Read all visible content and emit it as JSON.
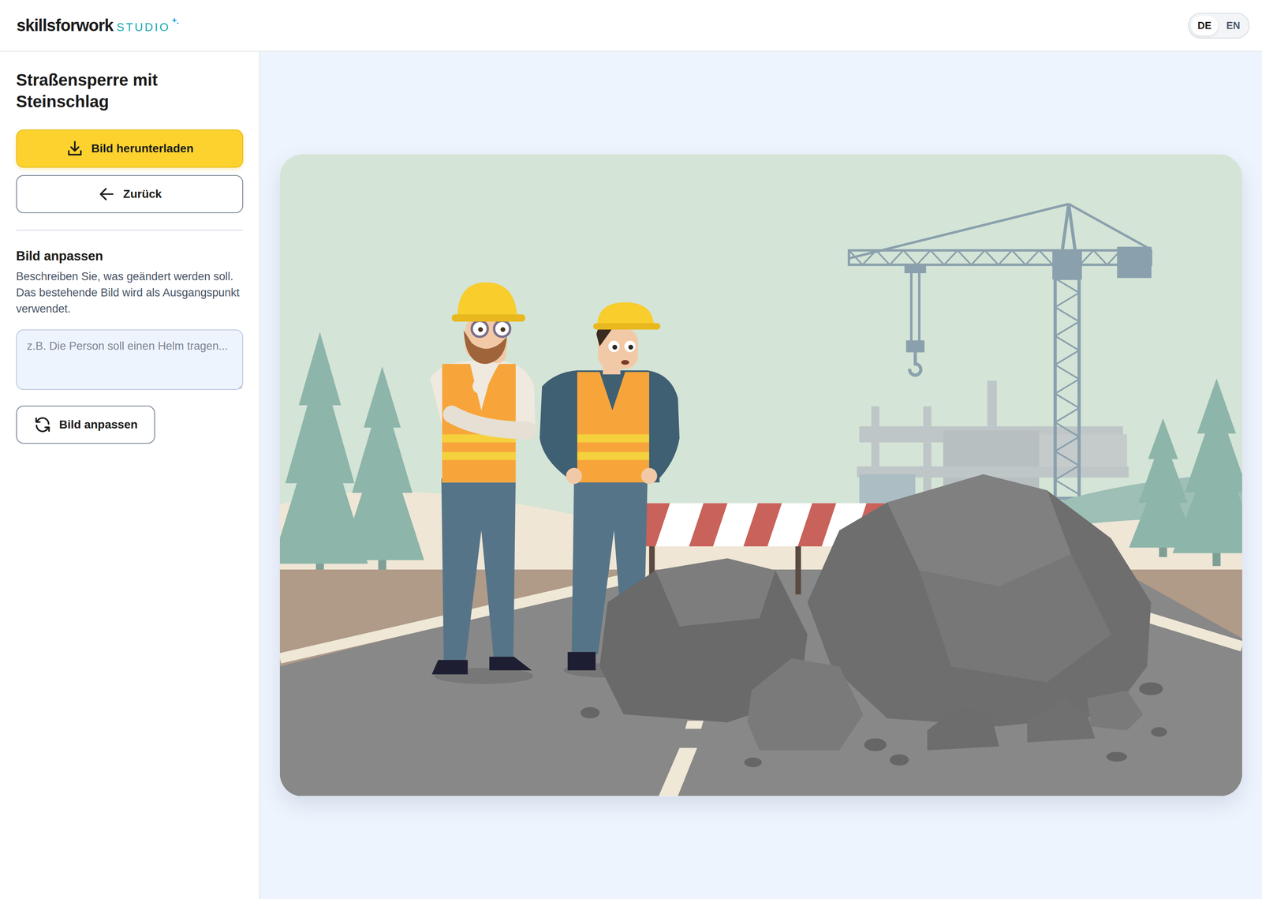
{
  "header": {
    "logo": {
      "brand": "skillsforwork",
      "product": "STUDIO"
    },
    "languages": [
      {
        "label": "DE",
        "selected": true
      },
      {
        "label": "EN",
        "selected": false
      }
    ]
  },
  "sidebar": {
    "title": "Straßensperre mit Steinschlag",
    "buttons": [
      {
        "label": "Bild herunterladen",
        "kind": "primary"
      },
      {
        "label": "Zurück",
        "kind": "back"
      }
    ],
    "edit": {
      "heading": "Bild anpassen",
      "description": "Beschreiben Sie, was geändert werden soll. Das bestehende Bild wird als Ausgangspunkt verwendet.",
      "placeholder": "z.B. Die Person soll einen Helm tragen...",
      "button": "Bild anpassen"
    }
  }
}
